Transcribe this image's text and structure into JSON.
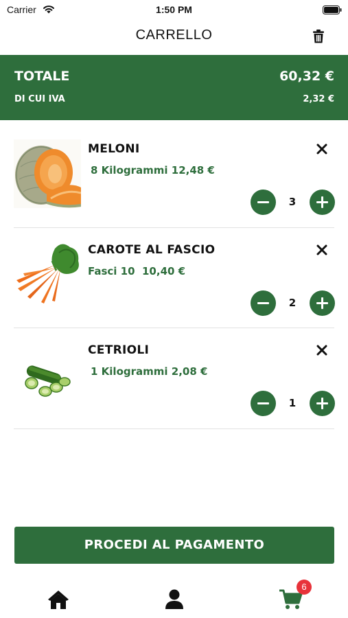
{
  "status_bar": {
    "carrier": "Carrier",
    "time": "1:50 PM"
  },
  "header": {
    "title": "CARRELLO"
  },
  "totals": {
    "total_label": "TOTALE",
    "total_value": "60,32 €",
    "vat_label": "DI CUI IVA",
    "vat_value": "2,32 €"
  },
  "cart": {
    "items": [
      {
        "name": "MELONI",
        "detail": "8 Kilogrammi 12,48 €",
        "quantity": "3",
        "icon": "melon-image"
      },
      {
        "name": "CAROTE AL FASCIO",
        "detail": "Fasci 10  10,40 €",
        "quantity": "2",
        "icon": "carrots-image"
      },
      {
        "name": "CETRIOLI",
        "detail": "1 Kilogrammi 2,08 €",
        "quantity": "1",
        "icon": "cucumber-image"
      }
    ]
  },
  "checkout": {
    "label": "PROCEDI AL PAGAMENTO"
  },
  "tab_bar": {
    "cart_badge": "6"
  },
  "colors": {
    "primary_green": "#2e6e3c",
    "badge_red": "#e8323a"
  }
}
